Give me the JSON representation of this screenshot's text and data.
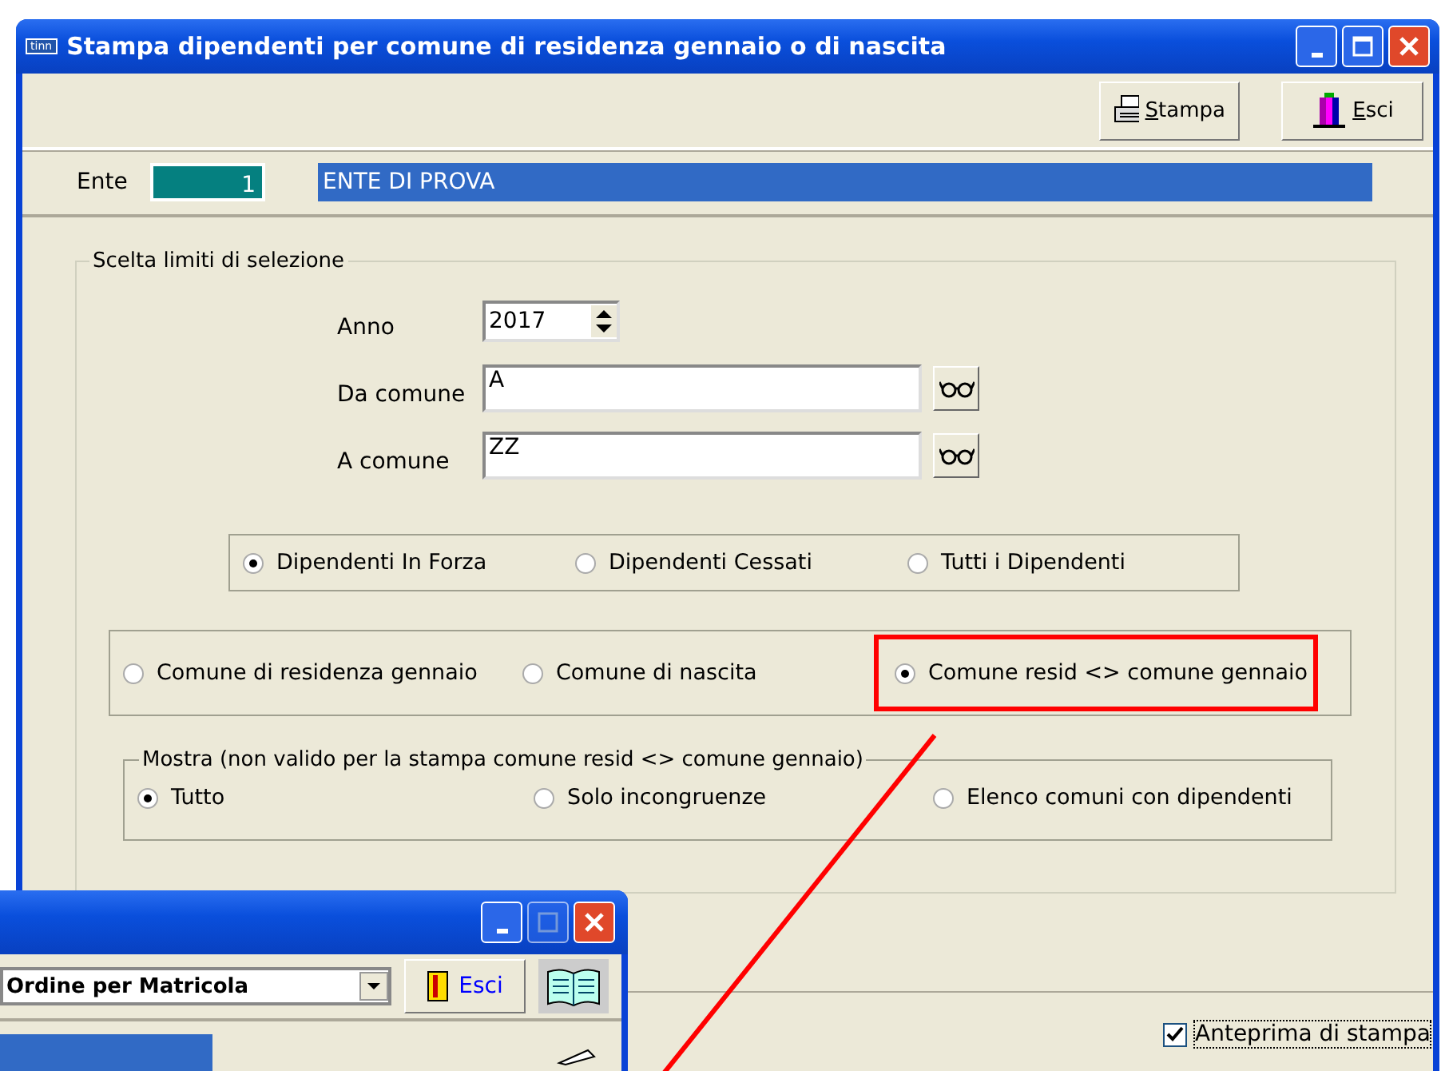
{
  "window": {
    "title": "Stampa dipendenti per comune di residenza gennaio o di nascita",
    "icon_text": "tinn"
  },
  "toolbar": [
    {
      "label": "Stampa",
      "kind": "print"
    },
    {
      "label": "Esci",
      "kind": "exit"
    }
  ],
  "ente": {
    "label": "Ente",
    "code": "1",
    "name": "ENTE DI PROVA"
  },
  "selection": {
    "title": "Scelta limiti di selezione",
    "fields": [
      {
        "label": "Anno",
        "value": "2017",
        "kind": "spinner"
      },
      {
        "label": "Da comune",
        "value": "A",
        "kind": "lookup"
      },
      {
        "label": "A comune",
        "value": "ZZ",
        "kind": "lookup"
      }
    ],
    "staff_filter": [
      {
        "label": "Dipendenti In Forza",
        "selected": true
      },
      {
        "label": "Dipendenti Cessati",
        "selected": false
      },
      {
        "label": "Tutti i Dipendenti",
        "selected": false
      }
    ],
    "print_type": [
      {
        "label": "Comune di residenza gennaio",
        "selected": false,
        "highlighted": false
      },
      {
        "label": "Comune di nascita",
        "selected": false,
        "highlighted": false
      },
      {
        "label": "Comune resid <> comune gennaio",
        "selected": true,
        "highlighted": true
      }
    ],
    "show": {
      "title": "Mostra (non valido per la stampa comune resid <> comune gennaio)",
      "options": [
        {
          "label": "Tutto",
          "selected": true
        },
        {
          "label": "Solo incongruenze",
          "selected": false
        },
        {
          "label": "Elenco comuni con dipendenti",
          "selected": false
        }
      ]
    }
  },
  "preview": {
    "label": "Anteprima di stampa",
    "checked": true
  },
  "second_window": {
    "order_dropdown": "Ordine per Matricola",
    "exit_button": "Esci"
  }
}
